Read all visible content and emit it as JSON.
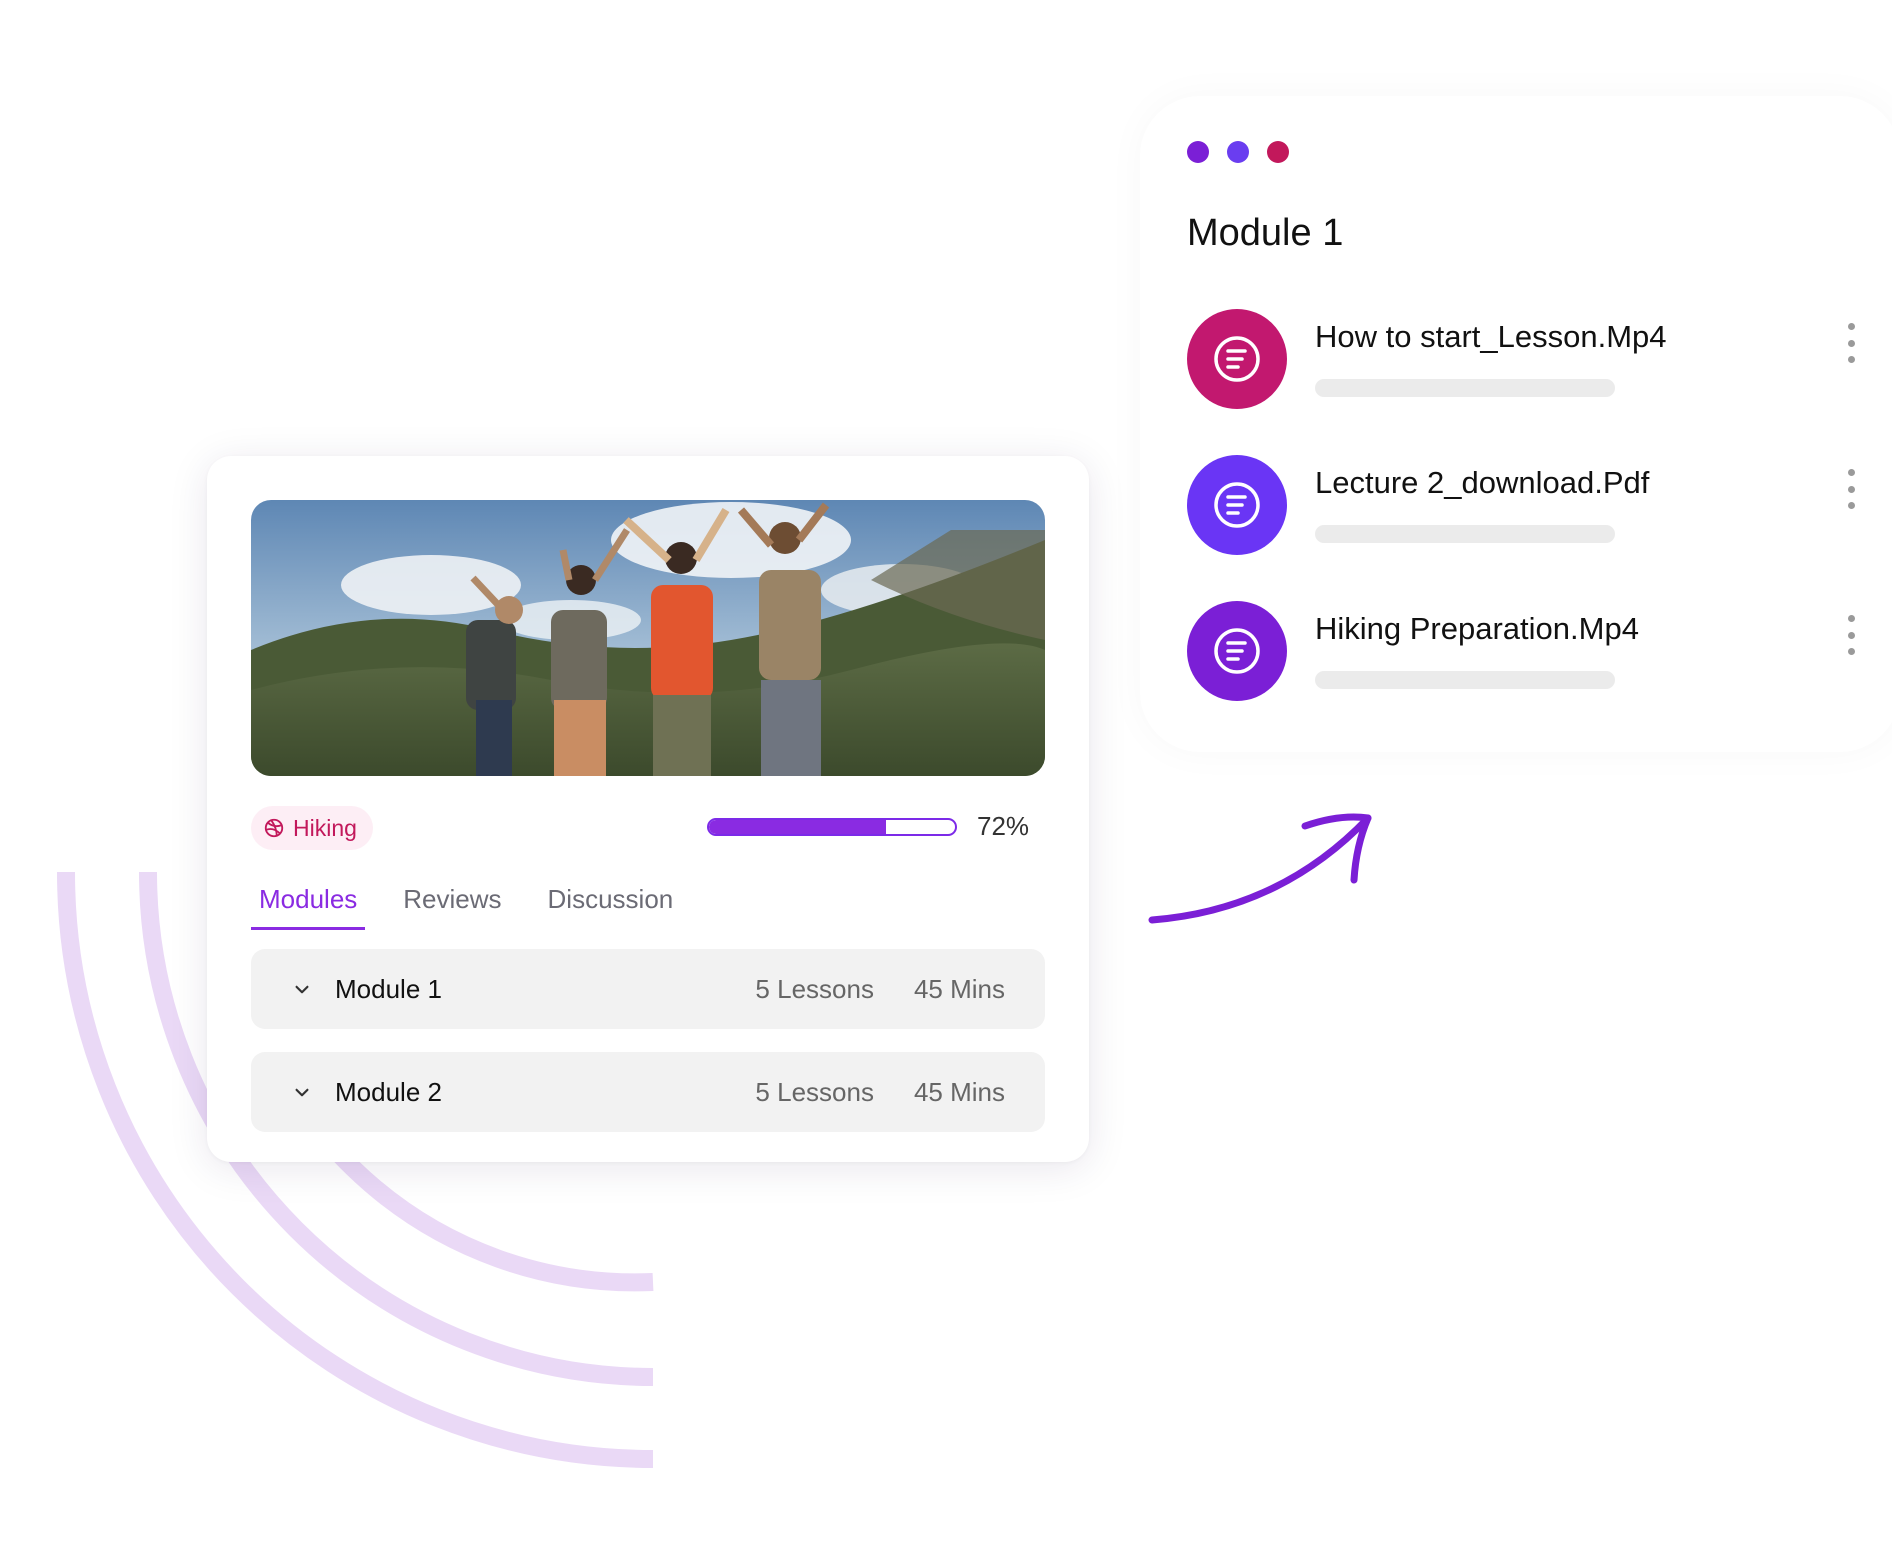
{
  "colors": {
    "accent": "#8a2be2",
    "arc": "#ead9f6",
    "tag_bg": "#fdeef5",
    "tag_text": "#c2185b",
    "dot_1": "#7b1fd6",
    "dot_2": "#6a3df0",
    "dot_3": "#c2185b"
  },
  "course_card": {
    "image_alt": "Hikers raising arms on mountain",
    "tag": {
      "icon": "dribbble-ball-icon",
      "label": "Hiking"
    },
    "progress": {
      "value": 0.72,
      "label": "72%"
    },
    "tabs": [
      {
        "label": "Modules",
        "active": true
      },
      {
        "label": "Reviews",
        "active": false
      },
      {
        "label": "Discussion",
        "active": false
      }
    ],
    "modules": [
      {
        "name": "Module 1",
        "lessons": "5 Lessons",
        "duration": "45 Mins",
        "icon": "chevron-down-icon"
      },
      {
        "name": "Module 2",
        "lessons": "5 Lessons",
        "duration": "45 Mins",
        "icon": "chevron-down-icon"
      }
    ]
  },
  "module_panel": {
    "title": "Module 1",
    "window_dots": [
      "#7b1fd6",
      "#6a3df0",
      "#c2185b"
    ],
    "lessons": [
      {
        "name": "How to start_Lesson.Mp4",
        "icon": "document-icon",
        "color": "#c2186f"
      },
      {
        "name": "Lecture 2_download.Pdf",
        "icon": "document-icon",
        "color": "#6a35f5"
      },
      {
        "name": "Hiking Preparation.Mp4",
        "icon": "document-icon",
        "color": "#7b1fd6"
      }
    ]
  }
}
